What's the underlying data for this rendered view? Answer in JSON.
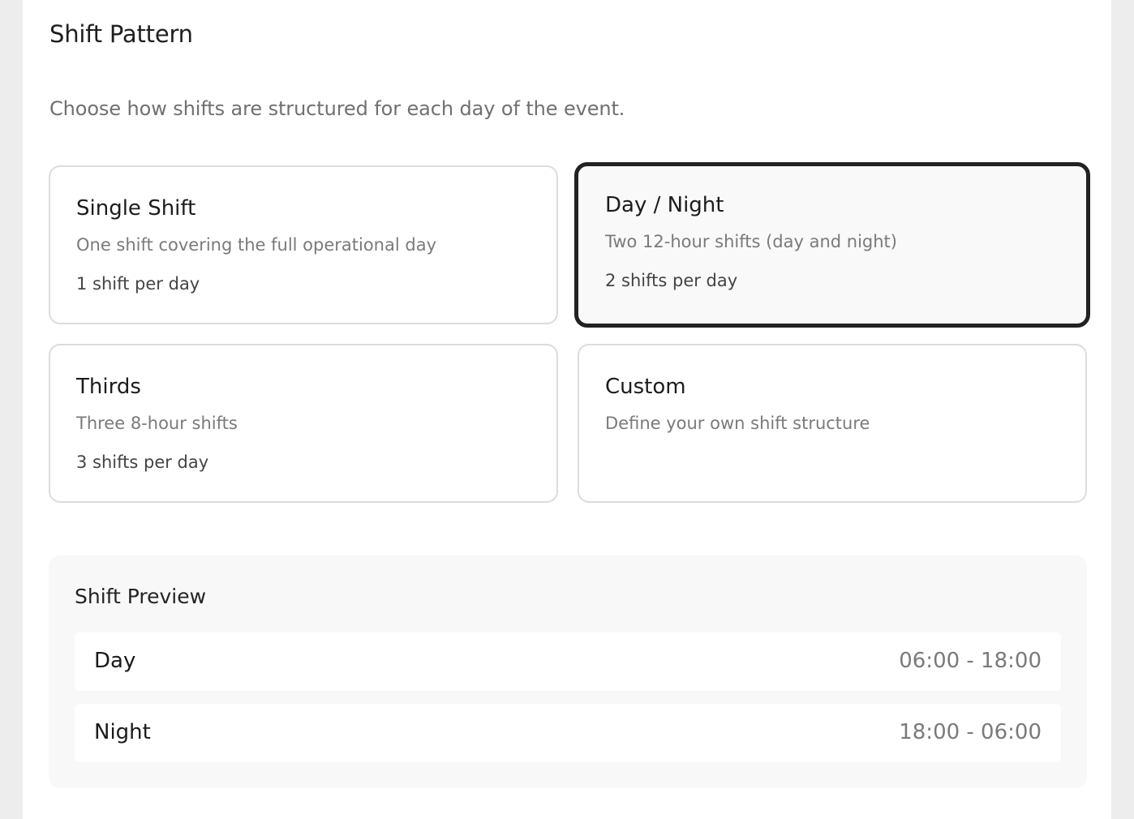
{
  "shift_pattern": {
    "title": "Shift Pattern",
    "description": "Choose how shifts are structured for each day of the event.",
    "options": [
      {
        "title": "Single Shift",
        "description": "One shift covering the full operational day",
        "count": "1 shift per day",
        "selected": false
      },
      {
        "title": "Day / Night",
        "description": "Two 12-hour shifts (day and night)",
        "count": "2 shifts per day",
        "selected": true
      },
      {
        "title": "Thirds",
        "description": "Three 8-hour shifts",
        "count": "3 shifts per day",
        "selected": false
      },
      {
        "title": "Custom",
        "description": "Define your own shift structure",
        "count": "",
        "selected": false
      }
    ]
  },
  "preview": {
    "title": "Shift Preview",
    "rows": [
      {
        "name": "Day",
        "time": "06:00 - 18:00"
      },
      {
        "name": "Night",
        "time": "18:00 - 06:00"
      }
    ]
  }
}
